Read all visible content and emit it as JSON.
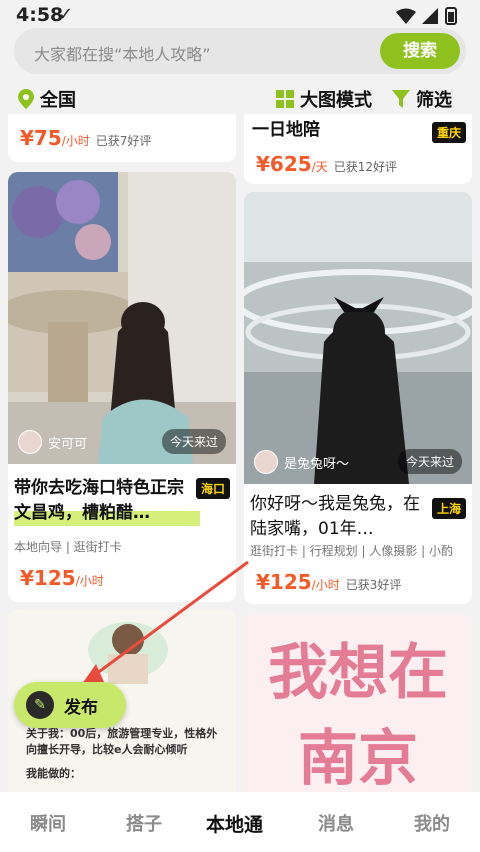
{
  "status_bar": {
    "time": "4:58"
  },
  "search": {
    "placeholder": "大家都在搜“本地人攻略”",
    "button_label": "搜索"
  },
  "filters": {
    "location": "全国",
    "view_mode": "大图模式",
    "filter": "筛选"
  },
  "cards": [
    {
      "id": "left-top",
      "price_value": "¥75",
      "price_unit": "/小时",
      "reviews": "已获7好评"
    },
    {
      "id": "right-top",
      "title": "一日地陪",
      "city": "重庆",
      "price_value": "¥625",
      "price_unit": "/天",
      "reviews": "已获12好评"
    },
    {
      "id": "left-mid",
      "user": "安可可",
      "today": "今天来过",
      "title": "带你去吃海口特色正宗文昌鸡，槽粕醋…",
      "city": "海口",
      "tags": "本地向导 | 逛街打卡",
      "price_value": "¥125",
      "price_unit": "/小时"
    },
    {
      "id": "right-mid",
      "user": "是兔兔呀～",
      "today": "今天来过",
      "title": "你好呀～我是兔兔，在陆家嘴，01年…",
      "city": "上海",
      "tags": "逛街打卡 | 行程规划 | 人像摄影 | 小酌",
      "price_value": "¥125",
      "price_unit": "/小时",
      "reviews": "已获3好评"
    },
    {
      "id": "left-bottom",
      "text_lines": [
        "关于我：00后，旅游管理专业，性格外向擅长开导，比较e人会耐心倾听",
        "我能做的："
      ]
    },
    {
      "id": "right-bottom",
      "big_text_1": "我想在",
      "big_text_2": "南京"
    }
  ],
  "fab": {
    "label": "发布"
  },
  "tabs": [
    "瞬间",
    "搭子",
    "本地通",
    "消息",
    "我的"
  ],
  "colors": {
    "accent": "#8fc21e",
    "price": "#f25a2a",
    "fab": "#c7e86a"
  }
}
